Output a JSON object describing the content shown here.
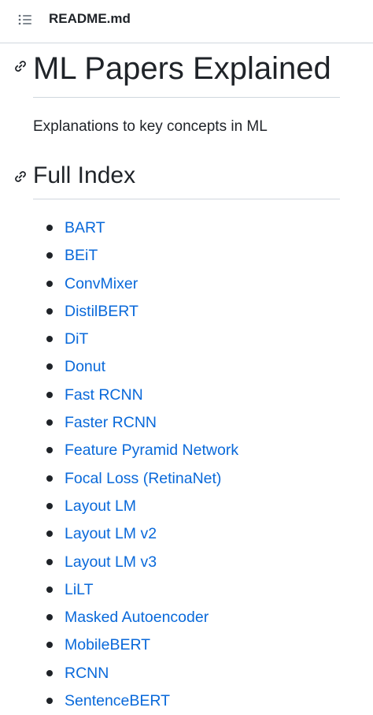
{
  "header": {
    "toc_icon": "list-unordered-icon",
    "file_name": "README.md"
  },
  "readme": {
    "title": "ML Papers Explained",
    "anchor_icon": "link-icon",
    "description": "Explanations to key concepts in ML",
    "section_title": "Full Index",
    "index_items": [
      {
        "label": "BART"
      },
      {
        "label": "BEiT"
      },
      {
        "label": "ConvMixer"
      },
      {
        "label": "DistilBERT"
      },
      {
        "label": "DiT"
      },
      {
        "label": "Donut"
      },
      {
        "label": "Fast RCNN"
      },
      {
        "label": "Faster RCNN"
      },
      {
        "label": "Feature Pyramid Network"
      },
      {
        "label": "Focal Loss (RetinaNet)"
      },
      {
        "label": "Layout LM"
      },
      {
        "label": "Layout LM v2"
      },
      {
        "label": "Layout LM v3"
      },
      {
        "label": "LiLT"
      },
      {
        "label": "Masked Autoencoder"
      },
      {
        "label": "MobileBERT"
      },
      {
        "label": "RCNN"
      },
      {
        "label": "SentenceBERT"
      }
    ]
  },
  "colors": {
    "text": "#1f2328",
    "link": "#0969da",
    "border": "#d0d7de",
    "icon": "#59636e"
  }
}
